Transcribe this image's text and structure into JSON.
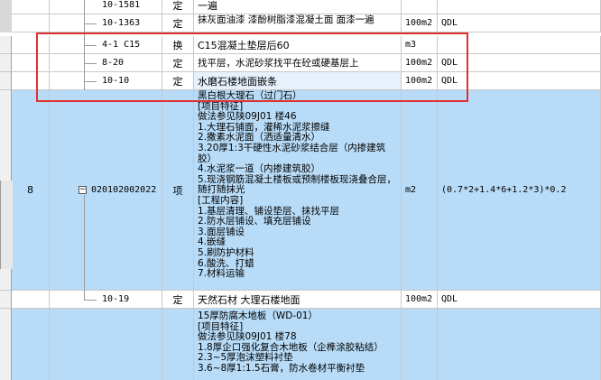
{
  "rows": [
    {
      "code": "10-1581",
      "type": "定",
      "desc": "一遍",
      "unit": "",
      "note": ""
    },
    {
      "code": "10-1363",
      "type": "定",
      "desc": "抹灰面油漆 漆酚树脂漆混凝土面 面漆一遍",
      "unit": "100m2",
      "note": "QDL"
    },
    {
      "code": "4-1 C15",
      "type": "换",
      "desc": "C15混凝土垫层后60",
      "unit": "m3",
      "note": ""
    },
    {
      "code": "8-20",
      "type": "定",
      "desc": "找平层，水泥砂浆找平在砼或硬基层上",
      "unit": "100m2",
      "note": "QDL"
    },
    {
      "code": "10-10",
      "type": "定",
      "desc": "水磨石楼地面嵌条",
      "unit": "100m2",
      "note": "QDL"
    }
  ],
  "big_row": {
    "index": "8",
    "code": "020102002022",
    "type": "项",
    "desc": "黑白根大理石（过门石）\n[项目特征]\n做法参见陕09J01  楼46\n1.大理石铺面，灌稀水泥浆擦缝\n2.撒素水泥面（洒适量清水）\n3.20厚1:3干硬性水泥砂浆结合层（内掺建筑胶）\n4.水泥浆一道（内掺建筑胶）\n5.现浇钢筋混凝土楼板或预制楼板现浇叠合层，随打随抹光\n[工程内容]\n1.基层清理、铺设垫层、抹找平层\n2.防水层铺设、填充层铺设\n3.面层铺设\n4.嵌缝\n5.刷防护材料\n6.酸洗、打蜡\n7.材料运输",
    "unit": "m2",
    "formula": "(0.7*2+1.4*6+1.2*3)*0.2"
  },
  "row_10_19": {
    "code": "10-19",
    "type": "定",
    "desc": "天然石材 大理石楼地面",
    "unit": "100m2",
    "note": "QDL"
  },
  "last_row": {
    "desc": "15厚防腐木地板（WD-01）\n[项目特征]\n做法参见陕09J01  楼78\n1.8厚企口强化复合木地板（企榫涂胶粘结）\n2.3~5厚泡沫塑料衬垫\n3.6~8厚1:1.5石膏，防水卷材平衡衬垫"
  }
}
